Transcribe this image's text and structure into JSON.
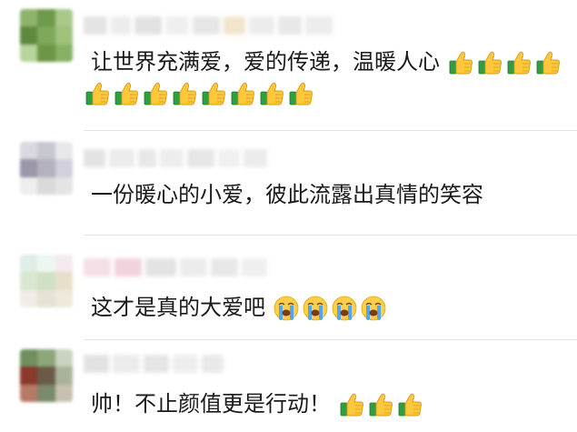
{
  "comments": [
    {
      "text": "让世界充满爱，爱的传递，温暖人心",
      "emoji": "thumbs-up",
      "emoji_count_line1": 4,
      "emoji_count_line2": 8
    },
    {
      "text": "一份暖心的小爱，彼此流露出真情的笑容",
      "emoji": "",
      "emoji_count_line1": 0
    },
    {
      "text": "这才是真的大爱吧",
      "emoji": "crying-face",
      "emoji_count_line1": 4
    },
    {
      "text": "帅！不止颜值更是行动！",
      "emoji": "thumbs-up",
      "emoji_count_line1": 3
    }
  ]
}
